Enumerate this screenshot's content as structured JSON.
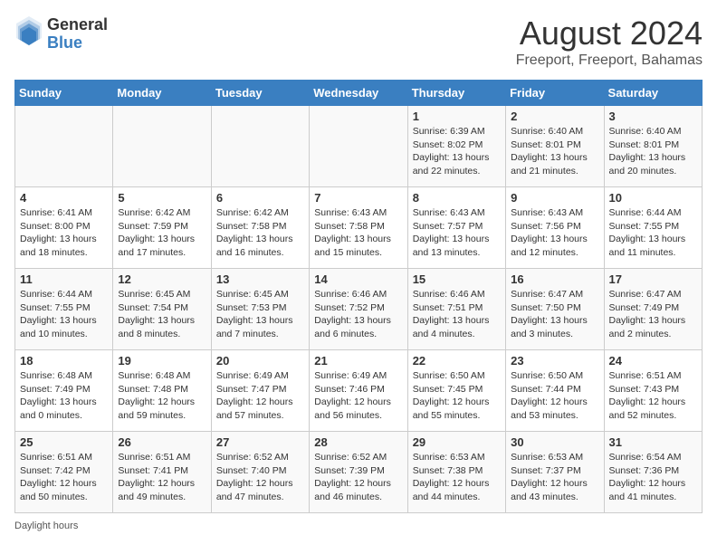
{
  "header": {
    "logo_general": "General",
    "logo_blue": "Blue",
    "title": "August 2024",
    "subtitle": "Freeport, Freeport, Bahamas"
  },
  "days_of_week": [
    "Sunday",
    "Monday",
    "Tuesday",
    "Wednesday",
    "Thursday",
    "Friday",
    "Saturday"
  ],
  "weeks": [
    [
      {
        "day": "",
        "info": ""
      },
      {
        "day": "",
        "info": ""
      },
      {
        "day": "",
        "info": ""
      },
      {
        "day": "",
        "info": ""
      },
      {
        "day": "1",
        "info": "Sunrise: 6:39 AM\nSunset: 8:02 PM\nDaylight: 13 hours and 22 minutes."
      },
      {
        "day": "2",
        "info": "Sunrise: 6:40 AM\nSunset: 8:01 PM\nDaylight: 13 hours and 21 minutes."
      },
      {
        "day": "3",
        "info": "Sunrise: 6:40 AM\nSunset: 8:01 PM\nDaylight: 13 hours and 20 minutes."
      }
    ],
    [
      {
        "day": "4",
        "info": "Sunrise: 6:41 AM\nSunset: 8:00 PM\nDaylight: 13 hours and 18 minutes."
      },
      {
        "day": "5",
        "info": "Sunrise: 6:42 AM\nSunset: 7:59 PM\nDaylight: 13 hours and 17 minutes."
      },
      {
        "day": "6",
        "info": "Sunrise: 6:42 AM\nSunset: 7:58 PM\nDaylight: 13 hours and 16 minutes."
      },
      {
        "day": "7",
        "info": "Sunrise: 6:43 AM\nSunset: 7:58 PM\nDaylight: 13 hours and 15 minutes."
      },
      {
        "day": "8",
        "info": "Sunrise: 6:43 AM\nSunset: 7:57 PM\nDaylight: 13 hours and 13 minutes."
      },
      {
        "day": "9",
        "info": "Sunrise: 6:43 AM\nSunset: 7:56 PM\nDaylight: 13 hours and 12 minutes."
      },
      {
        "day": "10",
        "info": "Sunrise: 6:44 AM\nSunset: 7:55 PM\nDaylight: 13 hours and 11 minutes."
      }
    ],
    [
      {
        "day": "11",
        "info": "Sunrise: 6:44 AM\nSunset: 7:55 PM\nDaylight: 13 hours and 10 minutes."
      },
      {
        "day": "12",
        "info": "Sunrise: 6:45 AM\nSunset: 7:54 PM\nDaylight: 13 hours and 8 minutes."
      },
      {
        "day": "13",
        "info": "Sunrise: 6:45 AM\nSunset: 7:53 PM\nDaylight: 13 hours and 7 minutes."
      },
      {
        "day": "14",
        "info": "Sunrise: 6:46 AM\nSunset: 7:52 PM\nDaylight: 13 hours and 6 minutes."
      },
      {
        "day": "15",
        "info": "Sunrise: 6:46 AM\nSunset: 7:51 PM\nDaylight: 13 hours and 4 minutes."
      },
      {
        "day": "16",
        "info": "Sunrise: 6:47 AM\nSunset: 7:50 PM\nDaylight: 13 hours and 3 minutes."
      },
      {
        "day": "17",
        "info": "Sunrise: 6:47 AM\nSunset: 7:49 PM\nDaylight: 13 hours and 2 minutes."
      }
    ],
    [
      {
        "day": "18",
        "info": "Sunrise: 6:48 AM\nSunset: 7:49 PM\nDaylight: 13 hours and 0 minutes."
      },
      {
        "day": "19",
        "info": "Sunrise: 6:48 AM\nSunset: 7:48 PM\nDaylight: 12 hours and 59 minutes."
      },
      {
        "day": "20",
        "info": "Sunrise: 6:49 AM\nSunset: 7:47 PM\nDaylight: 12 hours and 57 minutes."
      },
      {
        "day": "21",
        "info": "Sunrise: 6:49 AM\nSunset: 7:46 PM\nDaylight: 12 hours and 56 minutes."
      },
      {
        "day": "22",
        "info": "Sunrise: 6:50 AM\nSunset: 7:45 PM\nDaylight: 12 hours and 55 minutes."
      },
      {
        "day": "23",
        "info": "Sunrise: 6:50 AM\nSunset: 7:44 PM\nDaylight: 12 hours and 53 minutes."
      },
      {
        "day": "24",
        "info": "Sunrise: 6:51 AM\nSunset: 7:43 PM\nDaylight: 12 hours and 52 minutes."
      }
    ],
    [
      {
        "day": "25",
        "info": "Sunrise: 6:51 AM\nSunset: 7:42 PM\nDaylight: 12 hours and 50 minutes."
      },
      {
        "day": "26",
        "info": "Sunrise: 6:51 AM\nSunset: 7:41 PM\nDaylight: 12 hours and 49 minutes."
      },
      {
        "day": "27",
        "info": "Sunrise: 6:52 AM\nSunset: 7:40 PM\nDaylight: 12 hours and 47 minutes."
      },
      {
        "day": "28",
        "info": "Sunrise: 6:52 AM\nSunset: 7:39 PM\nDaylight: 12 hours and 46 minutes."
      },
      {
        "day": "29",
        "info": "Sunrise: 6:53 AM\nSunset: 7:38 PM\nDaylight: 12 hours and 44 minutes."
      },
      {
        "day": "30",
        "info": "Sunrise: 6:53 AM\nSunset: 7:37 PM\nDaylight: 12 hours and 43 minutes."
      },
      {
        "day": "31",
        "info": "Sunrise: 6:54 AM\nSunset: 7:36 PM\nDaylight: 12 hours and 41 minutes."
      }
    ]
  ],
  "footer": {
    "daylight_label": "Daylight hours"
  }
}
